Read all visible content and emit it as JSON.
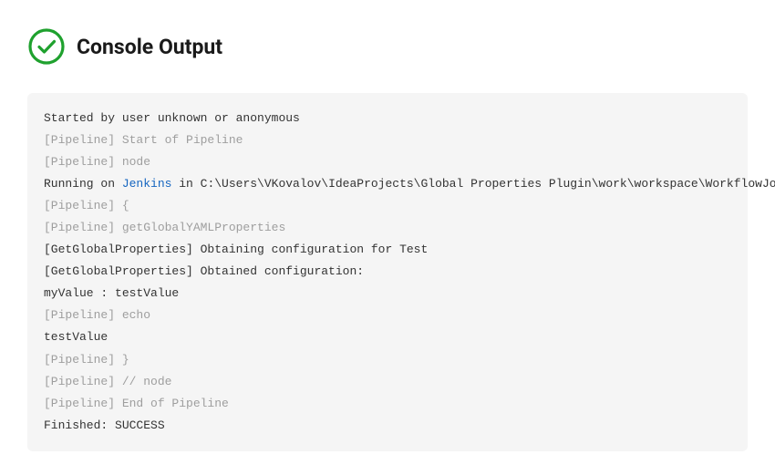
{
  "header": {
    "title": "Console Output"
  },
  "log": {
    "lines": [
      {
        "muted": false,
        "parts": [
          {
            "t": "Started by user unknown or anonymous"
          }
        ]
      },
      {
        "muted": true,
        "parts": [
          {
            "t": "[Pipeline] Start of Pipeline"
          }
        ]
      },
      {
        "muted": true,
        "parts": [
          {
            "t": "[Pipeline] node"
          }
        ]
      },
      {
        "muted": false,
        "parts": [
          {
            "t": "Running on "
          },
          {
            "t": "Jenkins",
            "link": true
          },
          {
            "t": " in C:\\Users\\VKovalov\\IdeaProjects\\Global Properties Plugin\\work\\workspace\\WorkflowJob"
          }
        ]
      },
      {
        "muted": true,
        "parts": [
          {
            "t": "[Pipeline] {"
          }
        ]
      },
      {
        "muted": true,
        "parts": [
          {
            "t": "[Pipeline] getGlobalYAMLProperties"
          }
        ]
      },
      {
        "muted": false,
        "parts": [
          {
            "t": "[GetGlobalProperties] Obtaining configuration for Test"
          }
        ]
      },
      {
        "muted": false,
        "parts": [
          {
            "t": "[GetGlobalProperties] Obtained configuration:"
          }
        ]
      },
      {
        "muted": false,
        "parts": [
          {
            "t": "myValue : testValue"
          }
        ]
      },
      {
        "muted": true,
        "parts": [
          {
            "t": "[Pipeline] echo"
          }
        ]
      },
      {
        "muted": false,
        "parts": [
          {
            "t": "testValue"
          }
        ]
      },
      {
        "muted": true,
        "parts": [
          {
            "t": "[Pipeline] }"
          }
        ]
      },
      {
        "muted": true,
        "parts": [
          {
            "t": "[Pipeline] // node"
          }
        ]
      },
      {
        "muted": true,
        "parts": [
          {
            "t": "[Pipeline] End of Pipeline"
          }
        ]
      },
      {
        "muted": false,
        "parts": [
          {
            "t": "Finished: SUCCESS"
          }
        ]
      }
    ]
  }
}
